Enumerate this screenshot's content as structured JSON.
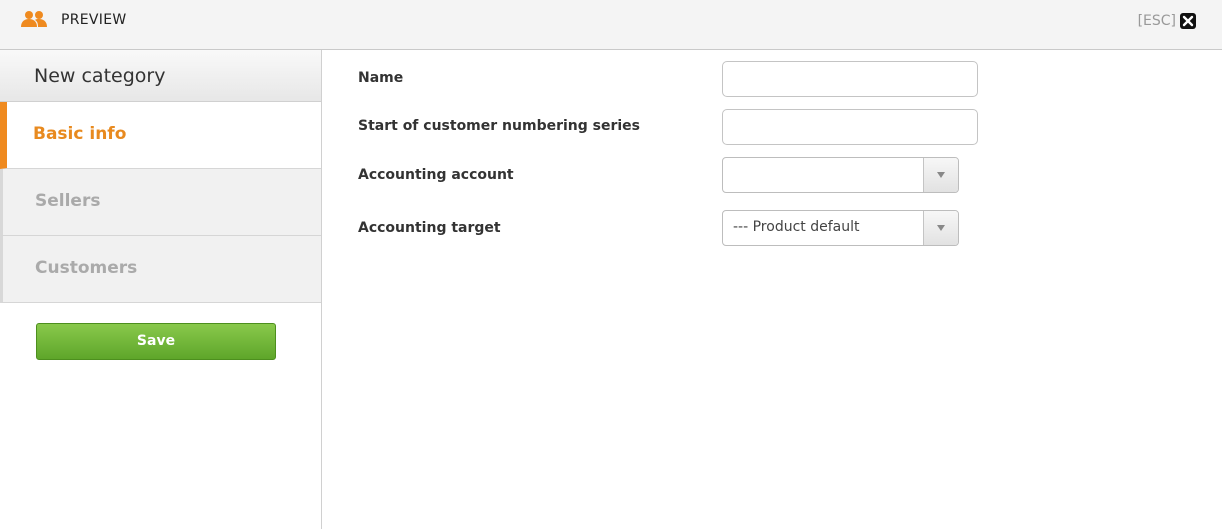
{
  "header": {
    "title": "PREVIEW",
    "esc_label": "[ESC]",
    "icon": "users-icon",
    "close_icon": "close-icon",
    "accent_color": "#ef8a1f"
  },
  "sidebar": {
    "heading": "New category",
    "items": [
      {
        "label": "Basic info",
        "active": true
      },
      {
        "label": "Sellers",
        "active": false
      },
      {
        "label": "Customers",
        "active": false
      }
    ],
    "save_label": "Save",
    "save_color": "#6db234"
  },
  "form": {
    "name": {
      "label": "Name",
      "value": ""
    },
    "numbering": {
      "label": "Start of customer numbering series",
      "value": ""
    },
    "account": {
      "label": "Accounting account",
      "value": ""
    },
    "target": {
      "label": "Accounting target",
      "value": "--- Product default"
    }
  }
}
